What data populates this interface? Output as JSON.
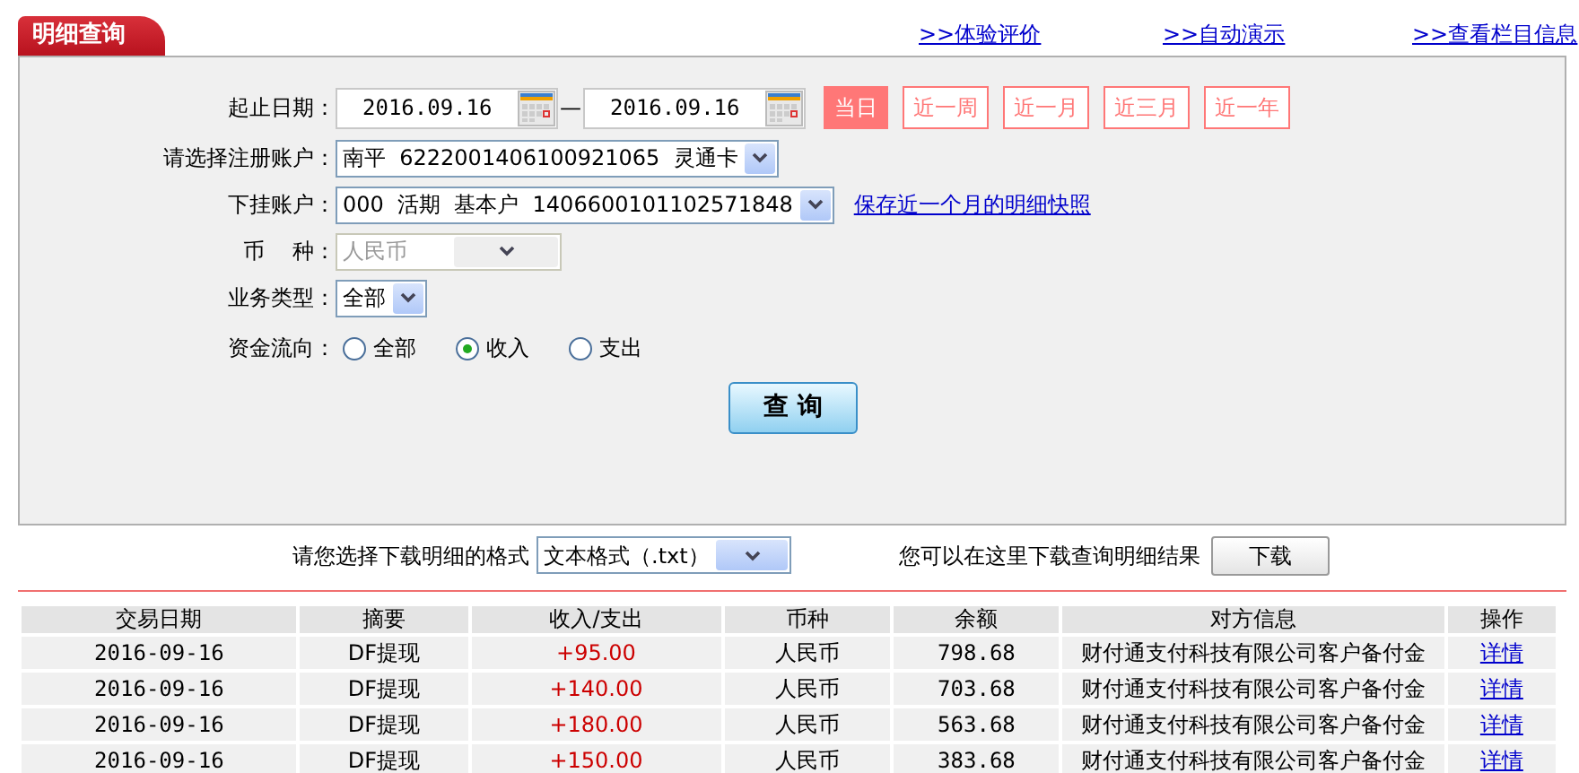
{
  "tab": {
    "label": "明细查询"
  },
  "top_links": [
    {
      "arrow": ">>",
      "label": "体验评价"
    },
    {
      "arrow": ">>",
      "label": "自动演示"
    },
    {
      "arrow": ">>",
      "label": "查看栏目信息"
    }
  ],
  "form": {
    "date_label": "起止日期：",
    "start_date": "2016.09.16",
    "date_separator": "—",
    "end_date": "2016.09.16",
    "quick_ranges": [
      {
        "label": "当日",
        "selected": true
      },
      {
        "label": "近一周",
        "selected": false
      },
      {
        "label": "近一月",
        "selected": false
      },
      {
        "label": "近三月",
        "selected": false
      },
      {
        "label": "近一年",
        "selected": false
      }
    ],
    "fields": [
      {
        "label": "请选择注册账户：",
        "value": "南平  6222001406100921065  灵通卡",
        "disabled": false
      },
      {
        "label": "下挂账户：",
        "value": "000  活期  基本户  1406600101102571848",
        "disabled": false,
        "link": "保存近一个月的明细快照"
      },
      {
        "label": "币    种：",
        "value": "人民币",
        "disabled": true
      },
      {
        "label": "业务类型：",
        "value": "全部",
        "disabled": false
      }
    ],
    "flow_label": "资金流向：",
    "flow_options": [
      {
        "label": "全部",
        "selected": false
      },
      {
        "label": "收入",
        "selected": true
      },
      {
        "label": "支出",
        "selected": false
      }
    ],
    "submit": "查 询"
  },
  "download": {
    "label": "请您选择下载明细的格式",
    "format": "文本格式（.txt）",
    "hint": "您可以在这里下载查询明细结果",
    "button": "下载"
  },
  "table": {
    "columns": [
      "交易日期",
      "摘要",
      "收入/支出",
      "币种",
      "余额",
      "对方信息",
      "操作"
    ],
    "rows": [
      {
        "cells": [
          "2016-09-16",
          "DF提现",
          "+95.00",
          "人民币",
          "798.68",
          "财付通支付科技有限公司客户备付金"
        ],
        "action": "详情"
      },
      {
        "cells": [
          "2016-09-16",
          "DF提现",
          "+140.00",
          "人民币",
          "703.68",
          "财付通支付科技有限公司客户备付金"
        ],
        "action": "详情"
      },
      {
        "cells": [
          "2016-09-16",
          "DF提现",
          "+180.00",
          "人民币",
          "563.68",
          "财付通支付科技有限公司客户备付金"
        ],
        "action": "详情"
      },
      {
        "cells": [
          "2016-09-16",
          "DF提现",
          "+150.00",
          "人民币",
          "383.68",
          "财付通支付科技有限公司客户备付金"
        ],
        "action": "详情"
      }
    ]
  }
}
